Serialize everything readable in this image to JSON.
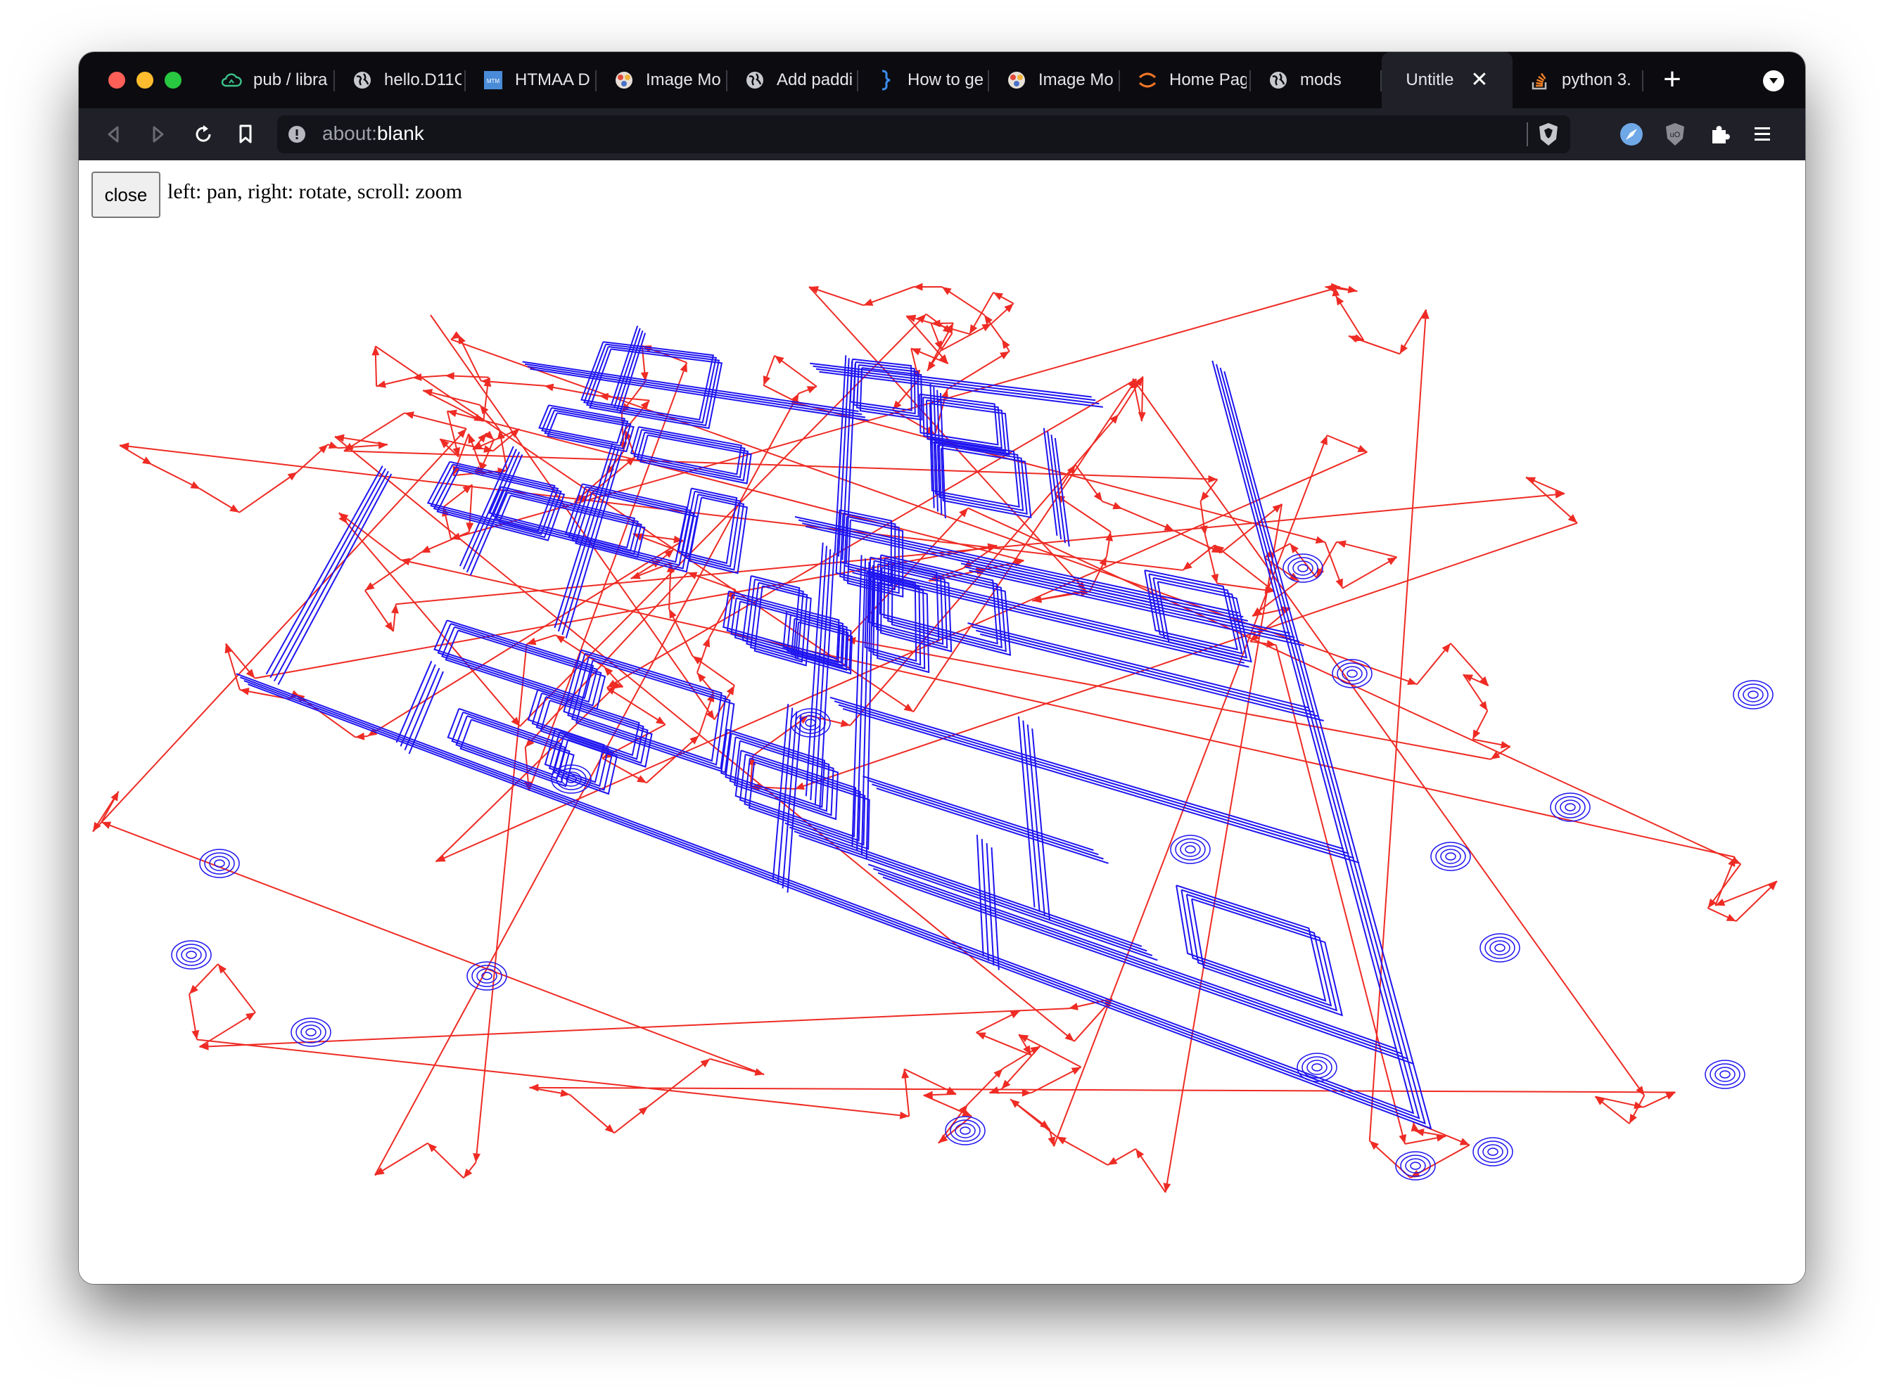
{
  "browser": {
    "tabs": [
      {
        "title": "pub / libra",
        "icon": "cloud-icon"
      },
      {
        "title": "hello.D11C",
        "icon": "globe-icon"
      },
      {
        "title": "HTMAA D",
        "icon": "mtm-icon"
      },
      {
        "title": "Image Mo",
        "icon": "mods-icon"
      },
      {
        "title": "Add paddi",
        "icon": "globe-icon"
      },
      {
        "title": "How to ge",
        "icon": "brace-icon"
      },
      {
        "title": "Image Mo",
        "icon": "mods-icon"
      },
      {
        "title": "Home Pag",
        "icon": "jupyter-icon"
      },
      {
        "title": "mods",
        "icon": "globe-icon"
      },
      {
        "title": "Untitle",
        "icon": "",
        "active": true
      },
      {
        "title": "python 3.",
        "icon": "stackoverflow-icon"
      }
    ],
    "new_tab_label": "+",
    "url": {
      "prefix": "about:",
      "rest": "blank"
    }
  },
  "page": {
    "close_label": "close",
    "hint": "left: pan, right: rotate, scroll: zoom"
  },
  "colors": {
    "trace_blue": "#1e14f0",
    "move_red": "#ee2b24"
  }
}
